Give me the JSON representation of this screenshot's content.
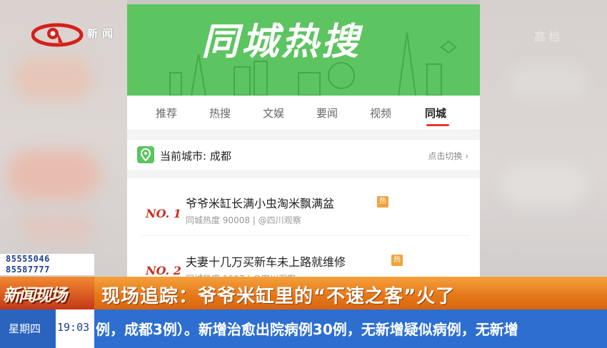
{
  "channel": {
    "logo_text": "新闻",
    "right_faded_text": "高档"
  },
  "banner": {
    "title": "同城热搜"
  },
  "tabs": [
    {
      "label": "推荐",
      "active": false
    },
    {
      "label": "热搜",
      "active": false
    },
    {
      "label": "文娱",
      "active": false
    },
    {
      "label": "要闻",
      "active": false
    },
    {
      "label": "视频",
      "active": false
    },
    {
      "label": "同城",
      "active": true
    }
  ],
  "city_bar": {
    "label": "当前城市: 成都",
    "switch_label": "点击切换 ›",
    "icon": "location-pin-icon"
  },
  "hot_list": [
    {
      "rank": "NO. 1",
      "title": "爷爷米缸长满小虫淘米飘满盆",
      "badge": "热",
      "meta": "同城热度 90008 | @四川观察"
    },
    {
      "rank": "NO. 2",
      "title": "夫妻十几万买新车未上路就维修",
      "badge": "热",
      "meta": "同城热度 1907 | @四川观察"
    }
  ],
  "broadcast": {
    "hotline_1": "85555046",
    "hotline_2": "85587777",
    "show_name": "新闻现场",
    "headline": "现场追踪：爷爷米缸里的“不速之客”火了",
    "day": "星期四",
    "time": "19:03",
    "ticker": "例，成都3例）。新增治愈出院病例30例，无新增疑似病例，无新增"
  },
  "colors": {
    "banner_green": "#5cc461",
    "accent_red": "#e23a2e",
    "headline_orange": "#e47718",
    "ticker_blue": "#2d6fd1"
  }
}
